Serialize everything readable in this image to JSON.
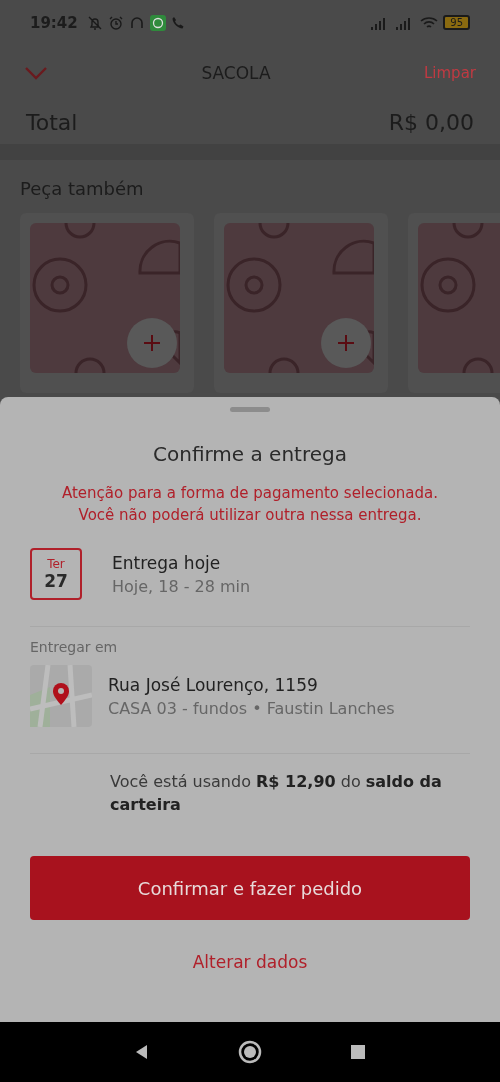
{
  "status_bar": {
    "time": "19:42",
    "battery": "95"
  },
  "header": {
    "title": "SACOLA",
    "clear": "Limpar"
  },
  "total": {
    "label": "Total",
    "value": "R$ 0,00"
  },
  "suggestions": {
    "title": "Peça também",
    "items": [
      {
        "kind": "picture",
        "add_button": true
      },
      {
        "kind": "picture",
        "add_button": true
      },
      {
        "kind": "picture",
        "add_button": false
      }
    ]
  },
  "sheet": {
    "title": "Confirme a entrega",
    "warning": [
      "Atenção para a forma de pagamento selecionada.",
      "Você não poderá utilizar outra nessa entrega."
    ],
    "delivery": {
      "day": "Ter",
      "date": "27",
      "title": "Entrega hoje",
      "time": "Hoje, 18 - 28 min"
    },
    "address": {
      "label": "Entregar em",
      "street": "Rua José Lourenço, 1159",
      "details": "CASA 03 - fundos • Faustin Lanches"
    },
    "wallet": "Você está usando **R$ 12,90** do **saldo da carteira**",
    "confirm_button": "Confirmar e fazer pedido",
    "change_link": "Alterar dados"
  }
}
